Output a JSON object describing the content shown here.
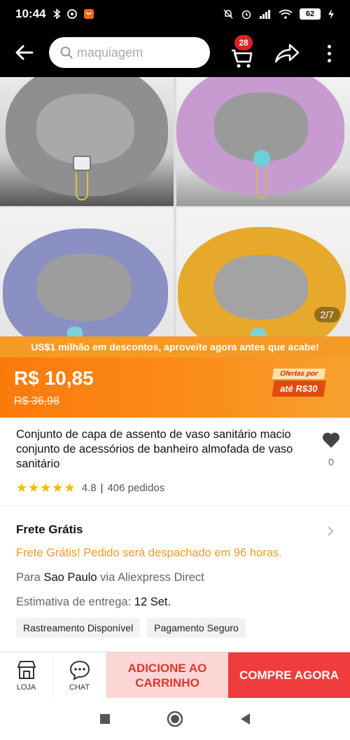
{
  "status_bar": {
    "time": "10:44",
    "battery": "62"
  },
  "search": {
    "placeholder": "maquiagem"
  },
  "cart": {
    "badge": "28"
  },
  "gallery": {
    "counter": "2/7",
    "images": [
      {
        "name": "gray-seat-cover",
        "color": "#8f8f8f"
      },
      {
        "name": "pink-seat-cover",
        "color": "#c79ad0"
      },
      {
        "name": "purple-seat-cover",
        "color": "#8a8fc4"
      },
      {
        "name": "yellow-seat-cover",
        "color": "#e7a92c"
      }
    ]
  },
  "promo": {
    "text": "US$1 milhão em descontos, aproveite agora antes que acabe!"
  },
  "price": {
    "current": "R$ 10,85",
    "original": "R$ 36,98",
    "offer_top": "Ofertas por",
    "offer_bottom": "até R$30"
  },
  "product": {
    "title": "Conjunto de capa de assento de vaso sanitário macio conjunto de acessórios de banheiro almofada de vaso sanitário",
    "wishlist_count": "0",
    "rating": "4.8",
    "orders": "406 pedidos"
  },
  "shipping": {
    "title": "Frete Grátis",
    "free_text": "Frete Grátis! Pedido será despachado em 96 horas.",
    "to_prefix": "Para ",
    "to_city": "Sao Paulo",
    "to_suffix": " via Aliexpress Direct",
    "eta_prefix": "Estimativa de entrega: ",
    "eta_date": "12 Set.",
    "tags": [
      "Rastreamento Disponível",
      "Pagamento Seguro"
    ]
  },
  "bottom": {
    "store_label": "LOJA",
    "chat_label": "CHAT",
    "add_cart": "ADICIONE AO CARRINHO",
    "buy_now": "COMPRE AGORA"
  },
  "colors": {
    "accent_orange": "#f59a26",
    "buy_red": "#f03c3c",
    "add_pink": "#fdd6d6"
  }
}
